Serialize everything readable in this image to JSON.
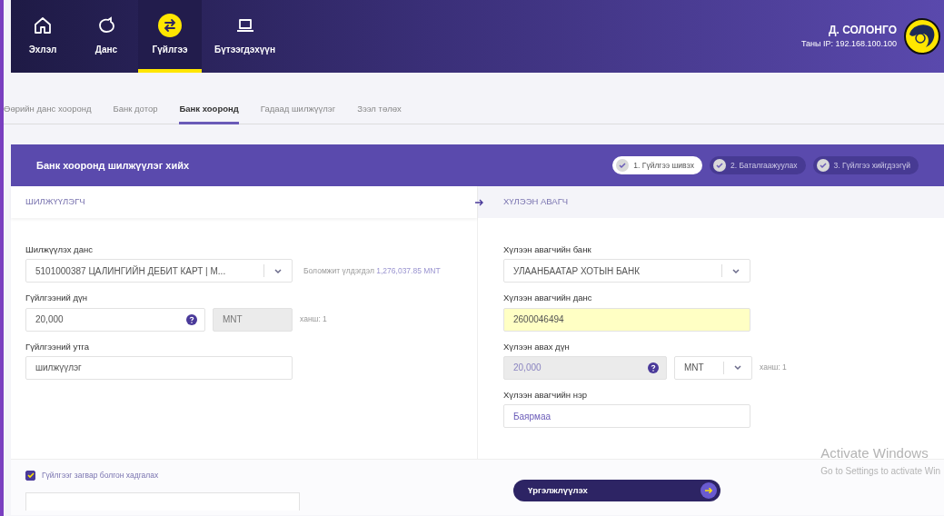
{
  "nav": {
    "items": [
      {
        "label": "Эхлэл",
        "selected": false
      },
      {
        "label": "Данс",
        "selected": false
      },
      {
        "label": "Гүйлгээ",
        "selected": true
      },
      {
        "label": "Бүтээгдэхүүн",
        "selected": false
      }
    ],
    "user": {
      "name": "Д. СОЛОНГО",
      "ip": "Таны IP: 192.168.100.100"
    }
  },
  "subtabs": [
    {
      "label": "Өөрийн данс хооронд",
      "selected": false
    },
    {
      "label": "Банк дотор",
      "selected": false
    },
    {
      "label": "Банк хооронд",
      "selected": true
    },
    {
      "label": "Гадаад шилжүүлэг",
      "selected": false
    },
    {
      "label": "Зээл төлөх",
      "selected": false
    }
  ],
  "panel": {
    "title": "Банк хооронд шилжүүлэг хийх",
    "steps": [
      {
        "label": "1. Гүйлгээ шивэх",
        "selected": true
      },
      {
        "label": "2. Баталгаажуулах",
        "selected": false
      },
      {
        "label": "3. Гүйлгээ хийгдээгүй",
        "selected": false
      }
    ]
  },
  "sender": {
    "heading": "ШИЛЖҮҮЛЭГЧ",
    "account": {
      "label": "Шилжүүлэх данс",
      "value": "5101000387 ЦАЛИНГИЙН ДЕБИТ КАРТ | M...",
      "balance_label": "Боломжит үлдэгдэл",
      "balance_value": "1,276,037.85 MNT"
    },
    "amount": {
      "label": "Гүйлгээний дүн",
      "value": "20,000",
      "disabled": false,
      "currency": {
        "value": "MNT",
        "kind": "static"
      },
      "rate": "ханш: 1"
    },
    "description": {
      "label": "Гүйлгээний утга",
      "value": "шилжүүлэг"
    }
  },
  "recipient": {
    "heading": "ХҮЛЭЭН АВАГЧ",
    "bank": {
      "label": "Хүлээн авагчийн банк",
      "value": "УЛААНБААТАР ХОТЫН БАНК"
    },
    "account": {
      "label": "Хүлээн авагчийн данс",
      "value": "2600046494",
      "highlighted": true
    },
    "amount": {
      "label": "Хүлээн авах дүн",
      "value": "20,000",
      "disabled": true,
      "currency": {
        "value": "MNT",
        "kind": "select"
      },
      "rate": "ханш: 1"
    },
    "name": {
      "label": "Хүлээн авагчийн нэр",
      "value": "Баярмаа"
    }
  },
  "save_template": {
    "label": "Гүйлгээг загвар болгон хадгалах",
    "checked": true
  },
  "continue_button": "Үргэлжлүүлэх",
  "windows_notice": {
    "title": "Activate Windows",
    "subtitle": "Go to Settings to activate Win"
  }
}
